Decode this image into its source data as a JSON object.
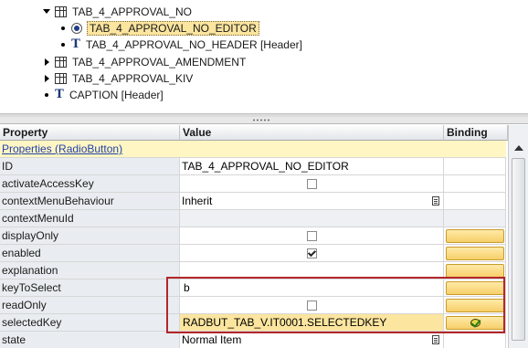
{
  "tree": {
    "nodes": [
      {
        "label": "TAB_4_APPROVAL_NO",
        "icon": "table-icon",
        "expander": "expanded"
      },
      {
        "label": "TAB_4_APPROVAL_NO_EDITOR",
        "icon": "radio-button-icon",
        "expander": "leaf",
        "selected": true
      },
      {
        "label": "TAB_4_APPROVAL_NO_HEADER  [Header]",
        "icon": "text-view-icon",
        "expander": "leaf"
      },
      {
        "label": "TAB_4_APPROVAL_AMENDMENT",
        "icon": "table-icon",
        "expander": "collapsed"
      },
      {
        "label": "TAB_4_APPROVAL_KIV",
        "icon": "table-icon",
        "expander": "collapsed"
      },
      {
        "label": "CAPTION  [Header]",
        "icon": "text-view-icon",
        "expander": "leaf"
      }
    ]
  },
  "grid": {
    "headers": {
      "property": "Property",
      "value": "Value",
      "binding": "Binding"
    },
    "group_label": "Properties (RadioButton)",
    "rows": [
      {
        "property": "ID",
        "value": "TAB_4_APPROVAL_NO_EDITOR",
        "kind": "text",
        "binding": "none"
      },
      {
        "property": "activateAccessKey",
        "value": "",
        "kind": "checkbox",
        "checked": false,
        "binding": "none"
      },
      {
        "property": "contextMenuBehaviour",
        "value": "Inherit",
        "kind": "select",
        "binding": "none"
      },
      {
        "property": "contextMenuId",
        "value": "",
        "kind": "readonly",
        "binding": "none"
      },
      {
        "property": "displayOnly",
        "value": "",
        "kind": "checkbox",
        "checked": false,
        "binding": "button"
      },
      {
        "property": "enabled",
        "value": "",
        "kind": "checkbox",
        "checked": true,
        "binding": "button"
      },
      {
        "property": "explanation",
        "value": "",
        "kind": "text",
        "binding": "button"
      },
      {
        "property": "keyToSelect",
        "value": "b",
        "kind": "text",
        "binding": "button"
      },
      {
        "property": "readOnly",
        "value": "",
        "kind": "checkbox",
        "checked": false,
        "binding": "button"
      },
      {
        "property": "selectedKey",
        "value": "RADBUT_TAB_V.IT0001.SELECTEDKEY",
        "kind": "bound",
        "binding": "bound"
      },
      {
        "property": "state",
        "value": "Normal Item",
        "kind": "select",
        "binding": "none"
      }
    ]
  },
  "colors": {
    "highlight": "#fbe59f",
    "group_bg": "#fff6c4",
    "binding_button": "#f6cf6a",
    "annotation_box": "#b3262b"
  }
}
